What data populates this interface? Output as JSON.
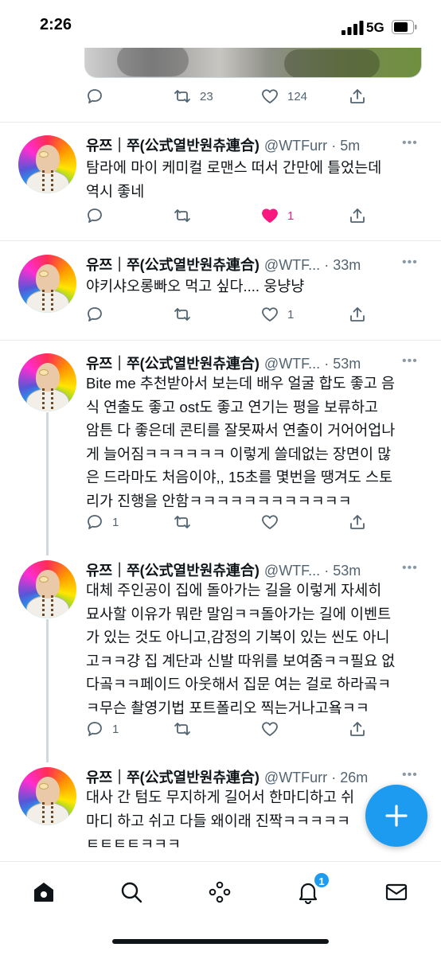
{
  "status_bar": {
    "time": "2:26",
    "network": "5G"
  },
  "top_tweet": {
    "retweets": "23",
    "likes": "124"
  },
  "tweets": [
    {
      "name": "유쯔｜쭈(公式열반원츄連合)",
      "handle": "@WTFurr",
      "time": "5m",
      "text": "탐라에 마이 케미컬 로맨스 떠서 간만에 틀었는데\n역시 좋네",
      "replies": "",
      "retweets": "",
      "likes": "1",
      "liked": true
    },
    {
      "name": "유쯔｜쭈(公式열반원츄連合)",
      "handle": "@WTF...",
      "time": "33m",
      "text": "야키샤오롱빠오 먹고 싶다.... 웅냥냥",
      "replies": "",
      "retweets": "",
      "likes": "1",
      "liked": false
    },
    {
      "name": "유쯔｜쭈(公式열반원츄連合)",
      "handle": "@WTF...",
      "time": "53m",
      "text": "Bite me 추천받아서 보는데 배우 얼굴 합도 좋고 음\n식 연출도 좋고 ost도 좋고  연기는 평을 보류하고\n암튼 다 좋은데 콘티를 잘못짜서 연출이 거어어업나\n게 늘어짐ㅋㅋㅋㅋㅋㅋ 이렇게 쓸데없는 장면이 많\n은 드라마도 처음이야,, 15초를 몇번을 땡겨도 스토\n리가 진행을 안함ㅋㅋㅋㅋㅋㅋㅋㅋㅋㅋㅋㅋ",
      "replies": "1",
      "retweets": "",
      "likes": "",
      "liked": false
    },
    {
      "name": "유쯔｜쭈(公式열반원츄連合)",
      "handle": "@WTF...",
      "time": "53m",
      "text": "대체 주인공이 집에 돌아가는 길을 이렇게 자세히\n묘사할 이유가 뭐란 말임ㅋㅋ돌아가는 길에 이벤트\n가 있는 것도 아니고,감정의 기복이 있는 씬도 아니\n고ㅋㅋ걍 집 계단과 신발 따위를 보여줌ㅋㅋ필요 없\n다곸ㅋㅋ페이드 아웃해서 집문 여는 걸로 하라곸ㅋ\nㅋ무슨 촬영기법 포트폴리오 찍는거나고욬ㅋㅋ",
      "replies": "1",
      "retweets": "",
      "likes": "",
      "liked": false
    },
    {
      "name": "유쯔｜쭈(公式열반원츄連合)",
      "handle": "@WTFurr",
      "time": "26m",
      "text": "대사 간 텀도 무지하게 길어서 한마디하고 쉬\n마디 하고 쉬고 다들 왜이래 진짝ㅋㅋㅋㅋㅋ\nㅌㅌㅌㅌㅋㅋㅋ",
      "replies": "",
      "retweets": "",
      "likes": "",
      "liked": false
    }
  ],
  "tabbar": {
    "notifications_badge": "1"
  },
  "icons": {
    "reply": "reply-icon",
    "retweet": "retweet-icon",
    "like": "heart-icon",
    "share": "share-icon",
    "home": "home-icon",
    "search": "search-icon",
    "spaces": "spaces-icon",
    "notifications": "bell-icon",
    "messages": "mail-icon",
    "compose": "plus-icon"
  },
  "colors": {
    "accent": "#1d9bf0",
    "like_active": "#f91880",
    "text_secondary": "#536471"
  }
}
